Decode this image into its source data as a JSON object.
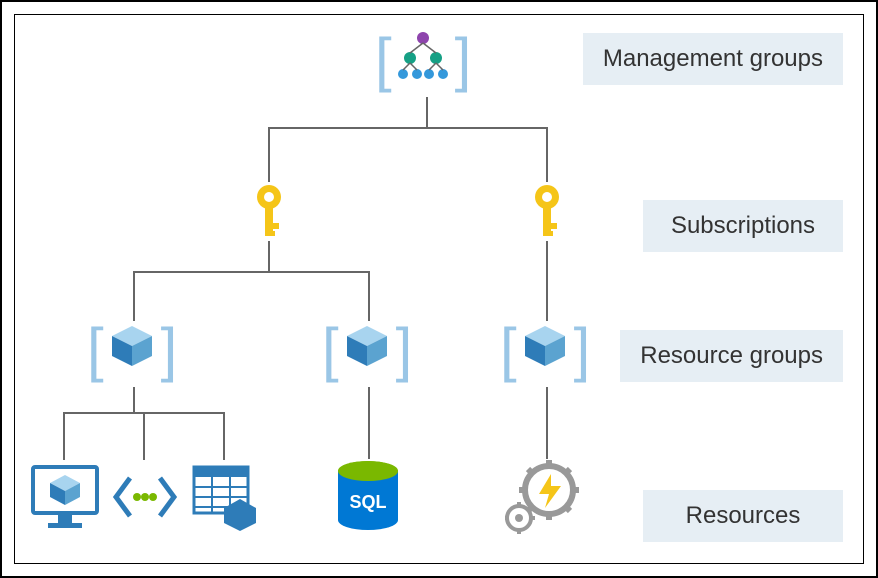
{
  "labels": {
    "management_groups": "Management groups",
    "subscriptions": "Subscriptions",
    "resource_groups": "Resource groups",
    "resources": "Resources"
  },
  "hierarchy": {
    "root": "management-group",
    "children": [
      {
        "type": "subscription",
        "children": [
          {
            "type": "resource-group",
            "resources": [
              "vm",
              "code",
              "storage-table"
            ]
          },
          {
            "type": "resource-group",
            "resources": [
              "sql-database"
            ]
          }
        ]
      },
      {
        "type": "subscription",
        "children": [
          {
            "type": "resource-group",
            "resources": [
              "function-app"
            ]
          }
        ]
      }
    ]
  },
  "icons": {
    "sql_label": "SQL"
  },
  "colors": {
    "bracket": "#9ac6e6",
    "label_bg": "#e6eef4",
    "cube_dark": "#2e7cb8",
    "cube_light": "#a8d4ef",
    "key": "#f5c518",
    "sql_green": "#7ab800",
    "sql_blue": "#0078d4",
    "gear": "#888",
    "bolt": "#f5c518",
    "tree_purple": "#8e44ad",
    "tree_teal": "#16a085",
    "tree_blue": "#3498db"
  }
}
